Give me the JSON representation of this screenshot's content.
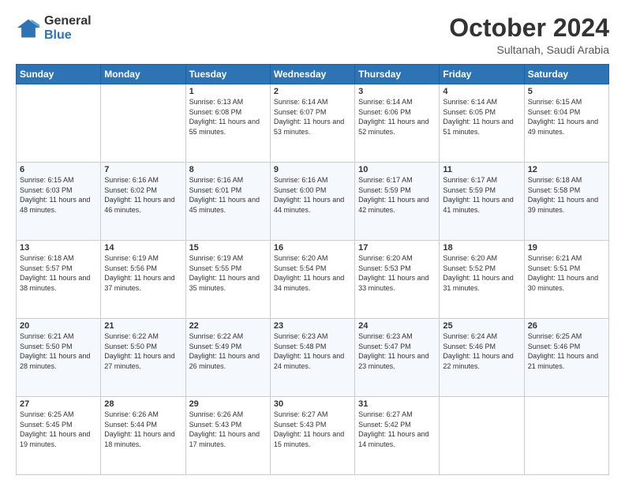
{
  "header": {
    "logo_general": "General",
    "logo_blue": "Blue",
    "month_year": "October 2024",
    "location": "Sultanah, Saudi Arabia"
  },
  "days_of_week": [
    "Sunday",
    "Monday",
    "Tuesday",
    "Wednesday",
    "Thursday",
    "Friday",
    "Saturday"
  ],
  "weeks": [
    [
      {
        "day": "",
        "sunrise": "",
        "sunset": "",
        "daylight": ""
      },
      {
        "day": "",
        "sunrise": "",
        "sunset": "",
        "daylight": ""
      },
      {
        "day": "1",
        "sunrise": "Sunrise: 6:13 AM",
        "sunset": "Sunset: 6:08 PM",
        "daylight": "Daylight: 11 hours and 55 minutes."
      },
      {
        "day": "2",
        "sunrise": "Sunrise: 6:14 AM",
        "sunset": "Sunset: 6:07 PM",
        "daylight": "Daylight: 11 hours and 53 minutes."
      },
      {
        "day": "3",
        "sunrise": "Sunrise: 6:14 AM",
        "sunset": "Sunset: 6:06 PM",
        "daylight": "Daylight: 11 hours and 52 minutes."
      },
      {
        "day": "4",
        "sunrise": "Sunrise: 6:14 AM",
        "sunset": "Sunset: 6:05 PM",
        "daylight": "Daylight: 11 hours and 51 minutes."
      },
      {
        "day": "5",
        "sunrise": "Sunrise: 6:15 AM",
        "sunset": "Sunset: 6:04 PM",
        "daylight": "Daylight: 11 hours and 49 minutes."
      }
    ],
    [
      {
        "day": "6",
        "sunrise": "Sunrise: 6:15 AM",
        "sunset": "Sunset: 6:03 PM",
        "daylight": "Daylight: 11 hours and 48 minutes."
      },
      {
        "day": "7",
        "sunrise": "Sunrise: 6:16 AM",
        "sunset": "Sunset: 6:02 PM",
        "daylight": "Daylight: 11 hours and 46 minutes."
      },
      {
        "day": "8",
        "sunrise": "Sunrise: 6:16 AM",
        "sunset": "Sunset: 6:01 PM",
        "daylight": "Daylight: 11 hours and 45 minutes."
      },
      {
        "day": "9",
        "sunrise": "Sunrise: 6:16 AM",
        "sunset": "Sunset: 6:00 PM",
        "daylight": "Daylight: 11 hours and 44 minutes."
      },
      {
        "day": "10",
        "sunrise": "Sunrise: 6:17 AM",
        "sunset": "Sunset: 5:59 PM",
        "daylight": "Daylight: 11 hours and 42 minutes."
      },
      {
        "day": "11",
        "sunrise": "Sunrise: 6:17 AM",
        "sunset": "Sunset: 5:59 PM",
        "daylight": "Daylight: 11 hours and 41 minutes."
      },
      {
        "day": "12",
        "sunrise": "Sunrise: 6:18 AM",
        "sunset": "Sunset: 5:58 PM",
        "daylight": "Daylight: 11 hours and 39 minutes."
      }
    ],
    [
      {
        "day": "13",
        "sunrise": "Sunrise: 6:18 AM",
        "sunset": "Sunset: 5:57 PM",
        "daylight": "Daylight: 11 hours and 38 minutes."
      },
      {
        "day": "14",
        "sunrise": "Sunrise: 6:19 AM",
        "sunset": "Sunset: 5:56 PM",
        "daylight": "Daylight: 11 hours and 37 minutes."
      },
      {
        "day": "15",
        "sunrise": "Sunrise: 6:19 AM",
        "sunset": "Sunset: 5:55 PM",
        "daylight": "Daylight: 11 hours and 35 minutes."
      },
      {
        "day": "16",
        "sunrise": "Sunrise: 6:20 AM",
        "sunset": "Sunset: 5:54 PM",
        "daylight": "Daylight: 11 hours and 34 minutes."
      },
      {
        "day": "17",
        "sunrise": "Sunrise: 6:20 AM",
        "sunset": "Sunset: 5:53 PM",
        "daylight": "Daylight: 11 hours and 33 minutes."
      },
      {
        "day": "18",
        "sunrise": "Sunrise: 6:20 AM",
        "sunset": "Sunset: 5:52 PM",
        "daylight": "Daylight: 11 hours and 31 minutes."
      },
      {
        "day": "19",
        "sunrise": "Sunrise: 6:21 AM",
        "sunset": "Sunset: 5:51 PM",
        "daylight": "Daylight: 11 hours and 30 minutes."
      }
    ],
    [
      {
        "day": "20",
        "sunrise": "Sunrise: 6:21 AM",
        "sunset": "Sunset: 5:50 PM",
        "daylight": "Daylight: 11 hours and 28 minutes."
      },
      {
        "day": "21",
        "sunrise": "Sunrise: 6:22 AM",
        "sunset": "Sunset: 5:50 PM",
        "daylight": "Daylight: 11 hours and 27 minutes."
      },
      {
        "day": "22",
        "sunrise": "Sunrise: 6:22 AM",
        "sunset": "Sunset: 5:49 PM",
        "daylight": "Daylight: 11 hours and 26 minutes."
      },
      {
        "day": "23",
        "sunrise": "Sunrise: 6:23 AM",
        "sunset": "Sunset: 5:48 PM",
        "daylight": "Daylight: 11 hours and 24 minutes."
      },
      {
        "day": "24",
        "sunrise": "Sunrise: 6:23 AM",
        "sunset": "Sunset: 5:47 PM",
        "daylight": "Daylight: 11 hours and 23 minutes."
      },
      {
        "day": "25",
        "sunrise": "Sunrise: 6:24 AM",
        "sunset": "Sunset: 5:46 PM",
        "daylight": "Daylight: 11 hours and 22 minutes."
      },
      {
        "day": "26",
        "sunrise": "Sunrise: 6:25 AM",
        "sunset": "Sunset: 5:46 PM",
        "daylight": "Daylight: 11 hours and 21 minutes."
      }
    ],
    [
      {
        "day": "27",
        "sunrise": "Sunrise: 6:25 AM",
        "sunset": "Sunset: 5:45 PM",
        "daylight": "Daylight: 11 hours and 19 minutes."
      },
      {
        "day": "28",
        "sunrise": "Sunrise: 6:26 AM",
        "sunset": "Sunset: 5:44 PM",
        "daylight": "Daylight: 11 hours and 18 minutes."
      },
      {
        "day": "29",
        "sunrise": "Sunrise: 6:26 AM",
        "sunset": "Sunset: 5:43 PM",
        "daylight": "Daylight: 11 hours and 17 minutes."
      },
      {
        "day": "30",
        "sunrise": "Sunrise: 6:27 AM",
        "sunset": "Sunset: 5:43 PM",
        "daylight": "Daylight: 11 hours and 15 minutes."
      },
      {
        "day": "31",
        "sunrise": "Sunrise: 6:27 AM",
        "sunset": "Sunset: 5:42 PM",
        "daylight": "Daylight: 11 hours and 14 minutes."
      },
      {
        "day": "",
        "sunrise": "",
        "sunset": "",
        "daylight": ""
      },
      {
        "day": "",
        "sunrise": "",
        "sunset": "",
        "daylight": ""
      }
    ]
  ]
}
